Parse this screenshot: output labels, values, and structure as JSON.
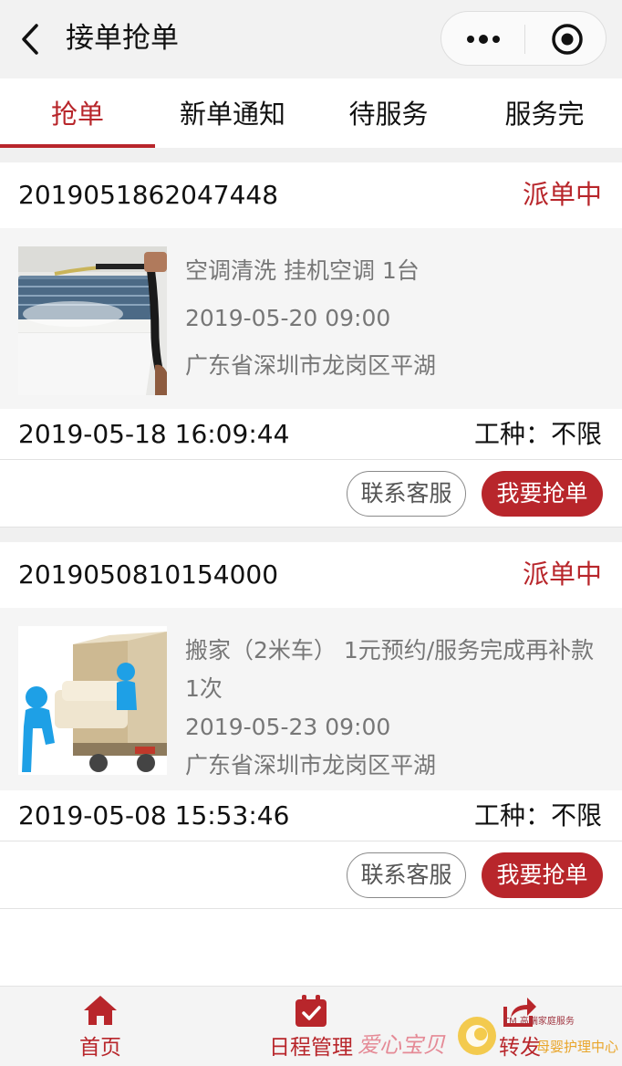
{
  "header": {
    "title": "接单抢单",
    "icons": {
      "back": "chevron-left-icon",
      "more": "more-dots-icon",
      "close": "target-circle-icon"
    }
  },
  "tabs": [
    {
      "label": "抢单",
      "active": true
    },
    {
      "label": "新单通知",
      "active": false
    },
    {
      "label": "待服务",
      "active": false
    },
    {
      "label": "服务完",
      "active": false
    }
  ],
  "orders": [
    {
      "id": "2019051862047448",
      "status": "派单中",
      "service": "空调清洗 挂机空调 1台",
      "appointment": "2019-05-20 09:00",
      "address": "广东省深圳市龙岗区平湖",
      "created": "2019-05-18 16:09:44",
      "work_type": "工种：不限",
      "contact_label": "联系客服",
      "grab_label": "我要抢单"
    },
    {
      "id": "2019050810154000",
      "status": "派单中",
      "service": "搬家（2米车） 1元预约/服务完成再补款 1次",
      "appointment": "2019-05-23 09:00",
      "address": "广东省深圳市龙岗区平湖",
      "created": "2019-05-08 15:53:46",
      "work_type": "工种：不限",
      "contact_label": "联系客服",
      "grab_label": "我要抢单"
    }
  ],
  "bottom_nav": [
    {
      "label": "首页",
      "icon": "home-icon"
    },
    {
      "label": "日程管理",
      "icon": "calendar-check-icon"
    },
    {
      "label": "转发",
      "icon": "share-icon"
    }
  ],
  "watermark": {
    "text": "爱心宝贝",
    "small_text": "TM 高端家庭服务",
    "care_text": "母婴护理中心"
  },
  "colors": {
    "accent": "#b8262b",
    "background": "#f2f2f2",
    "muted_text": "#777777"
  }
}
